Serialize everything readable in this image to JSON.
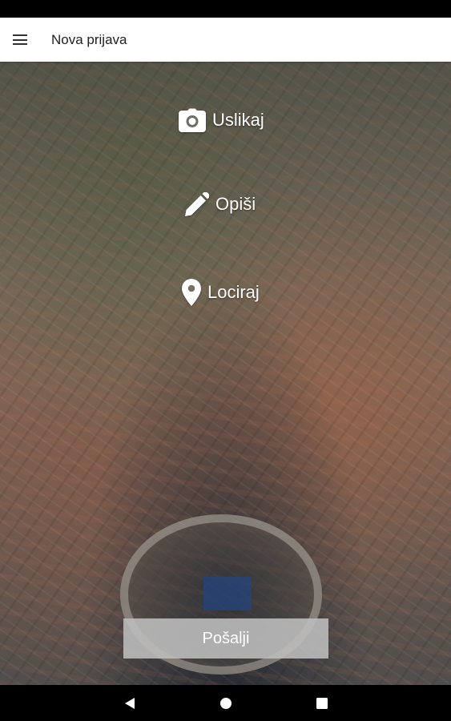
{
  "app_bar": {
    "title": "Nova prijava",
    "menu_icon": "menu-icon"
  },
  "actions": [
    {
      "label": "Uslikaj",
      "icon": "camera-icon"
    },
    {
      "label": "Opiši",
      "icon": "pencil-icon"
    },
    {
      "label": "Lociraj",
      "icon": "location-pin-icon"
    }
  ],
  "send_button": {
    "label": "Pošalji"
  },
  "nav_bar": {
    "back_icon": "back-triangle-icon",
    "home_icon": "home-circle-icon",
    "recents_icon": "recents-square-icon"
  },
  "colors": {
    "app_bar_bg": "#ffffff",
    "send_button_bg": "#bebebe",
    "system_bars": "#000000"
  }
}
